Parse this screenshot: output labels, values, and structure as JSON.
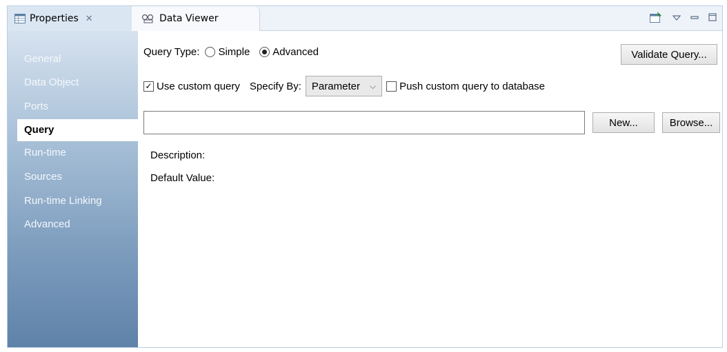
{
  "tabs": [
    {
      "label": "Properties",
      "close": "✕",
      "icon": "table-icon"
    },
    {
      "label": "Data Viewer",
      "icon": "data-viewer-icon"
    }
  ],
  "toolbar": {
    "icons": [
      "pin-icon",
      "view-menu-icon",
      "minimize-icon",
      "maximize-icon"
    ]
  },
  "sidebar": {
    "items": [
      {
        "label": "General",
        "selected": false
      },
      {
        "label": "Data Object",
        "selected": false
      },
      {
        "label": "Ports",
        "selected": false
      },
      {
        "label": "Query",
        "selected": true
      },
      {
        "label": "Run-time",
        "selected": false
      },
      {
        "label": "Sources",
        "selected": false
      },
      {
        "label": "Run-time Linking",
        "selected": false
      },
      {
        "label": "Advanced",
        "selected": false
      }
    ]
  },
  "query": {
    "type_label": "Query Type:",
    "simple_label": "Simple",
    "advanced_label": "Advanced",
    "selected_type": "Advanced",
    "validate_label": "Validate Query...",
    "use_custom_label": "Use custom query",
    "use_custom_checked": true,
    "specify_by_label": "Specify By:",
    "specify_by_value": "Parameter",
    "push_label": "Push custom query to database",
    "push_checked": false,
    "query_value": "",
    "new_label": "New...",
    "browse_label": "Browse...",
    "description_label": "Description:",
    "default_value_label": "Default Value:"
  },
  "colors": {
    "accent": "#dbe6f3",
    "sidebar_top": "#d6e2ef",
    "sidebar_bottom": "#5f82a8"
  }
}
